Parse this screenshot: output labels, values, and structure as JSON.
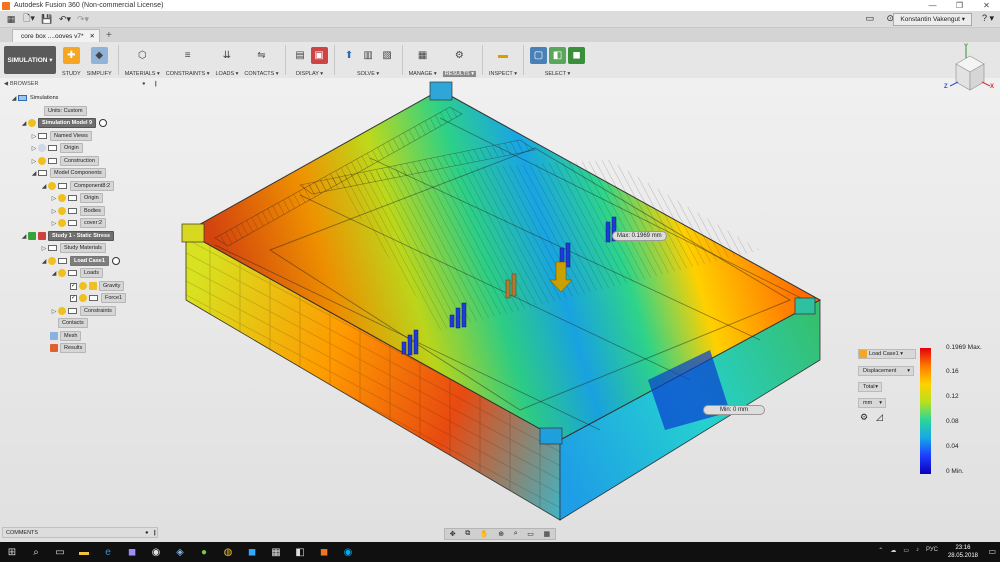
{
  "window": {
    "title": "Autodesk Fusion 360 (Non-commercial License)"
  },
  "qat": {
    "user": "Konstantin Vakengut ▾",
    "help": "? ▾"
  },
  "tabs": [
    {
      "label": "core box ....ooves v7*"
    }
  ],
  "toolbar": {
    "workspace": "SIMULATION ▾",
    "groups": [
      {
        "label": "STUDY"
      },
      {
        "label": "SIMPLIFY"
      },
      {
        "label": "MATERIALS ▾"
      },
      {
        "label": "CONSTRAINTS ▾"
      },
      {
        "label": "LOADS ▾"
      },
      {
        "label": "CONTACTS ▾"
      },
      {
        "label": "DISPLAY ▾"
      },
      {
        "label": "SOLVE ▾"
      },
      {
        "label": "MANAGE ▾"
      },
      {
        "label": "RESULTS ▾"
      },
      {
        "label": "INSPECT ▾"
      },
      {
        "label": "SELECT ▾"
      }
    ]
  },
  "browser": {
    "title": "BROWSER",
    "items": [
      {
        "label": "Simulations"
      },
      {
        "label": "Units: Custom"
      },
      {
        "label": "Simulation Model 9"
      },
      {
        "label": "Named Views"
      },
      {
        "label": "Origin"
      },
      {
        "label": "Construction"
      },
      {
        "label": "Model Components"
      },
      {
        "label": "Component8:2"
      },
      {
        "label": "Origin"
      },
      {
        "label": "Bodies"
      },
      {
        "label": "cover:2"
      },
      {
        "label": "Study 1 - Static Stress"
      },
      {
        "label": "Study Materials"
      },
      {
        "label": "Load Case1"
      },
      {
        "label": "Loads"
      },
      {
        "label": "Gravity"
      },
      {
        "label": "Force1"
      },
      {
        "label": "Constraints"
      },
      {
        "label": "Contacts"
      },
      {
        "label": "Mesh"
      },
      {
        "label": "Results"
      }
    ]
  },
  "comments": {
    "title": "COMMENTS"
  },
  "probes": {
    "max": "Max: 0.1969 mm",
    "min": "Min: 0 mm"
  },
  "legend": {
    "load_case": "Load Case1 ▾",
    "result_type": "Displacement",
    "component": "Total",
    "units": "mm",
    "ticks": [
      "0.1969 Max.",
      "0.16",
      "0.12",
      "0.08",
      "0.04",
      "0 Min."
    ]
  },
  "viewcube": {
    "letters": [
      "Y",
      "Z",
      "X"
    ]
  },
  "taskbar": {
    "lang": "РУС",
    "time": "23:16",
    "date": "28.05.2018"
  },
  "colors": {
    "accent": "#0696d7",
    "workspace": "#5a5a5a"
  }
}
